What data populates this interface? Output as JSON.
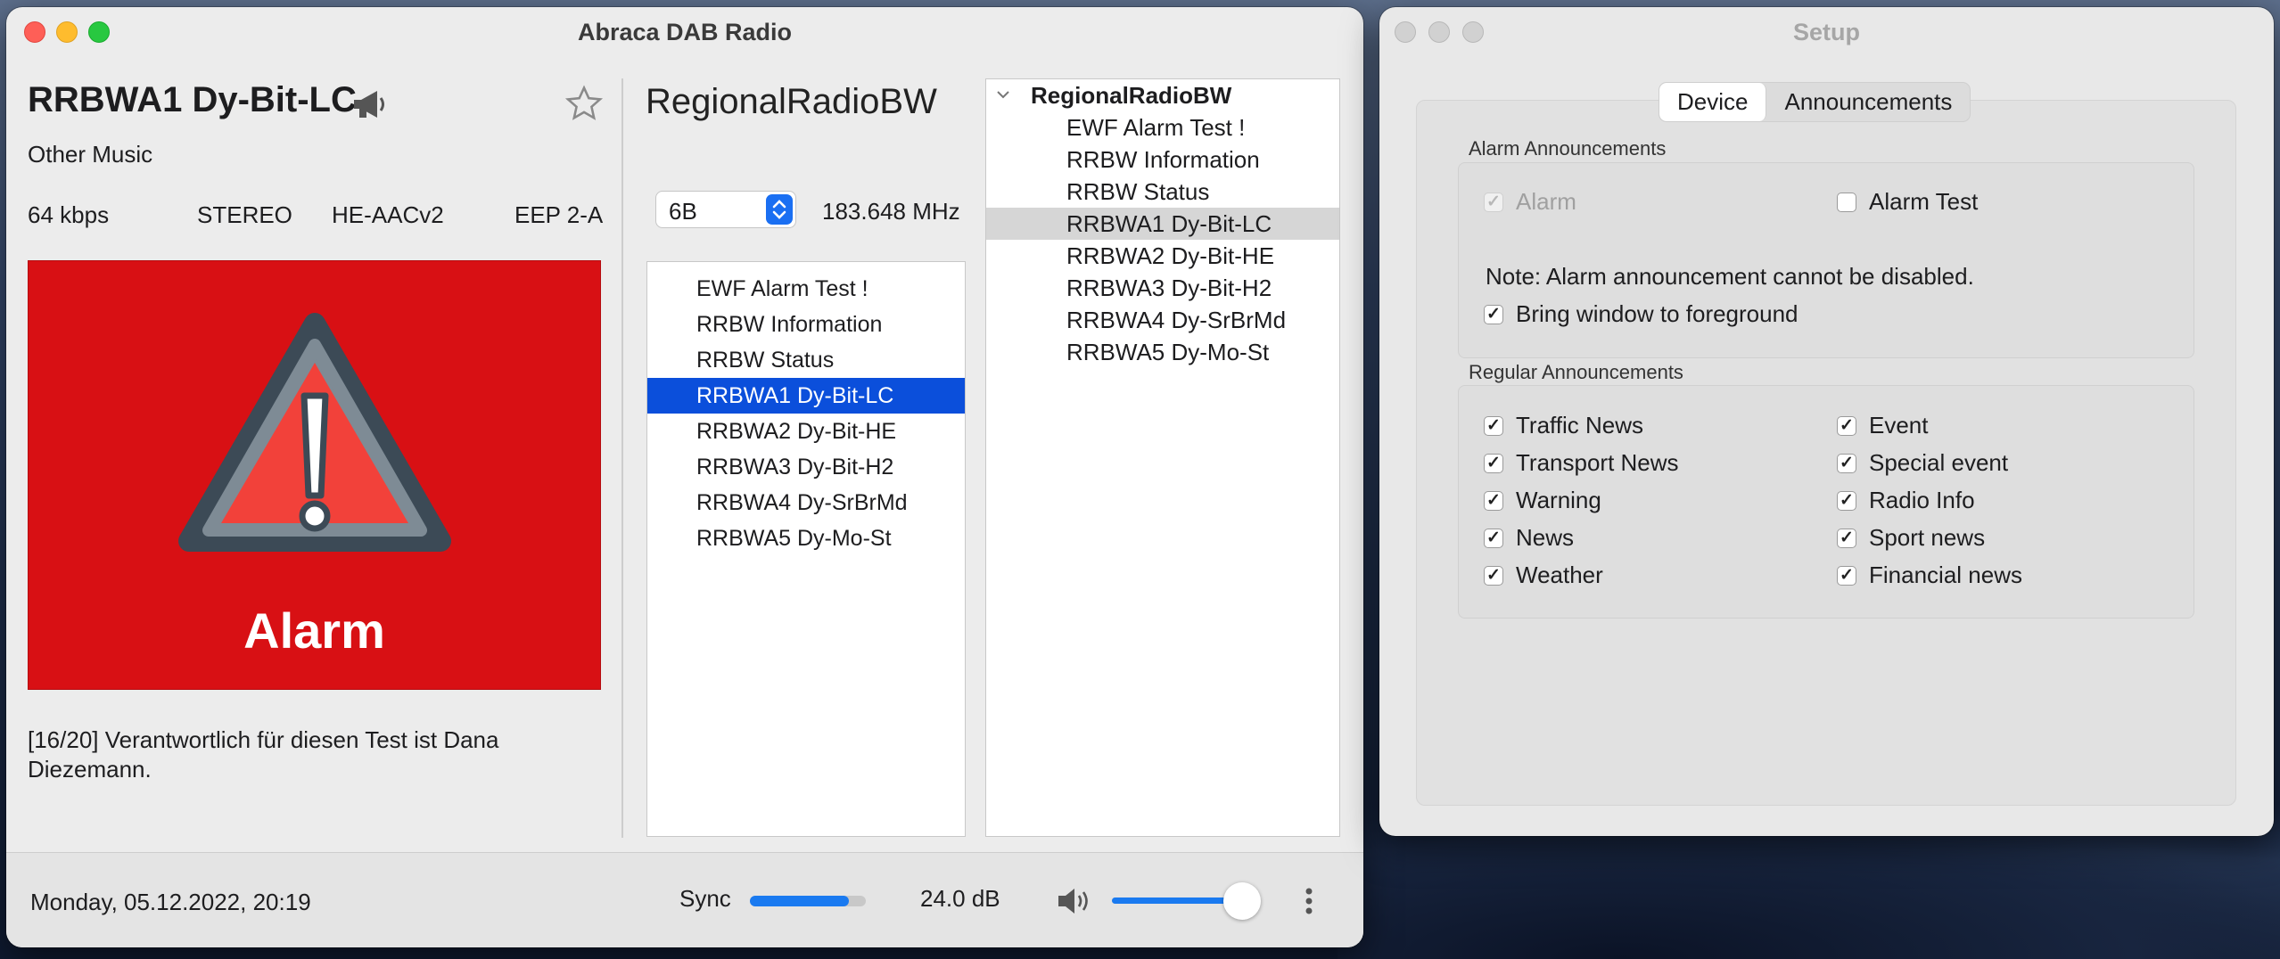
{
  "main_window": {
    "title": "Abraca DAB Radio",
    "station": {
      "name": "RRBWA1 Dy-Bit-LC",
      "genre": "Other Music",
      "bitrate": "64 kbps",
      "mode": "STEREO",
      "codec": "HE-AACv2",
      "protection": "EEP 2-A"
    },
    "slide": {
      "label": "Alarm",
      "bg_color": "#d81014"
    },
    "dls_text": "[16/20] Verantwortlich für diesen Test ist Dana Diezemann.",
    "ensemble": {
      "name": "RegionalRadioBW",
      "channel": "6B",
      "frequency": "183.648 MHz"
    },
    "services": [
      "EWF Alarm Test !",
      "RRBW Information",
      "RRBW Status",
      "RRBWA1 Dy-Bit-LC",
      "RRBWA2 Dy-Bit-HE",
      "RRBWA3 Dy-Bit-H2",
      "RRBWA4 Dy-SrBrMd",
      "RRBWA5 Dy-Mo-St"
    ],
    "selected_service_index": 3,
    "tree": {
      "root": "RegionalRadioBW",
      "children": [
        "EWF Alarm Test !",
        "RRBW Information",
        "RRBW Status",
        "RRBWA1 Dy-Bit-LC",
        "RRBWA2 Dy-Bit-HE",
        "RRBWA3 Dy-Bit-H2",
        "RRBWA4 Dy-SrBrMd",
        "RRBWA5 Dy-Mo-St"
      ],
      "highlighted_index": 3
    },
    "status": {
      "datetime": "Monday, 05.12.2022, 20:19",
      "sync_label": "Sync",
      "sync_level": 0.85,
      "snr": "24.0 dB",
      "volume_level": 0.89
    },
    "accent_color": "#0b4fdb"
  },
  "setup_window": {
    "title": "Setup",
    "tabs": [
      "Device",
      "Announcements"
    ],
    "active_tab": "Device",
    "alarm_group": {
      "label": "Alarm Announcements",
      "alarm": "Alarm",
      "alarm_test": "Alarm Test",
      "note": "Note: Alarm announcement cannot be disabled.",
      "bring_to_front": "Bring window to foreground"
    },
    "regular_group": {
      "label": "Regular Announcements",
      "left": [
        "Traffic News",
        "Transport News",
        "Warning",
        "News",
        "Weather"
      ],
      "right": [
        "Event",
        "Special event",
        "Radio Info",
        "Sport news",
        "Financial news"
      ]
    }
  }
}
